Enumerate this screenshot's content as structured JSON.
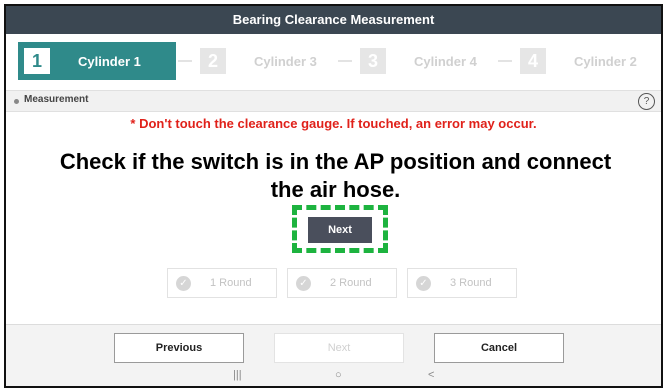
{
  "title": "Bearing Clearance Measurement",
  "steps": [
    {
      "num": "1",
      "label": "Cylinder 1"
    },
    {
      "num": "2",
      "label": "Cylinder 3"
    },
    {
      "num": "3",
      "label": "Cylinder 4"
    },
    {
      "num": "4",
      "label": "Cylinder 2"
    }
  ],
  "section": {
    "label": "Measurement",
    "help_label": "?"
  },
  "warning": "* Don't touch the clearance gauge. If touched, an error may occur.",
  "instruction": "Check if the switch is in the AP position and connect the air hose.",
  "next_main_label": "Next",
  "rounds": [
    {
      "label": "1 Round",
      "check": "✓"
    },
    {
      "label": "2 Round",
      "check": "✓"
    },
    {
      "label": "3 Round",
      "check": "✓"
    }
  ],
  "footer": {
    "previous_label": "Previous",
    "next_label": "Next",
    "cancel_label": "Cancel"
  },
  "system_nav": {
    "recent": "|||",
    "home": "○",
    "back": "<"
  },
  "colors": {
    "titlebar": "#3b4752",
    "active_step": "#2f8a8a",
    "warning": "#e0211a",
    "highlight": "#1db33f",
    "next_button": "#4a4f5c"
  }
}
